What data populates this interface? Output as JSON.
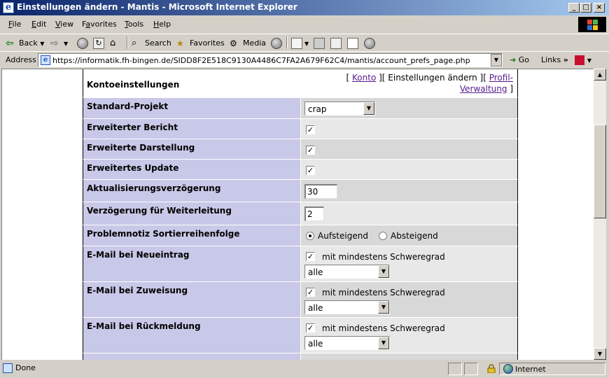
{
  "window": {
    "title": "Einstellungen ändern - Mantis - Microsoft Internet Explorer"
  },
  "menu": [
    {
      "label": "File",
      "key": "F",
      "rest": "ile"
    },
    {
      "label": "Edit",
      "key": "E",
      "rest": "dit"
    },
    {
      "label": "View",
      "key": "V",
      "rest": "iew"
    },
    {
      "label": "Favorites",
      "key": "a",
      "pre": "F",
      "rest": "vorites"
    },
    {
      "label": "Tools",
      "key": "T",
      "rest": "ools"
    },
    {
      "label": "Help",
      "key": "H",
      "rest": "elp"
    }
  ],
  "toolbar": {
    "back": "Back",
    "search": "Search",
    "favorites": "Favorites",
    "media": "Media"
  },
  "address": {
    "label": "Address",
    "url": "https://informatik.fh-bingen.de/SIDD8F2E518C9130A4486C7FA2A679F62C4/mantis/account_prefs_page.php",
    "go": "Go",
    "links": "Links"
  },
  "prefs": {
    "title": "Kontoeinstellungen",
    "link_konto": "Konto",
    "current": " ][ Einstellungen ändern ][ ",
    "link_profil_a": "Profil-",
    "link_profil_b": "Verwaltung",
    "bracket_open": "[ ",
    "bracket_close": " ]",
    "rows": [
      {
        "label": "Standard-Projekt",
        "value": "crap"
      },
      {
        "label": "Erweiterter Bericht",
        "checked": true
      },
      {
        "label": "Erweiterte Darstellung",
        "checked": true
      },
      {
        "label": "Erweitertes Update",
        "checked": true
      },
      {
        "label": "Aktualisierungsverzögerung",
        "value": "30"
      },
      {
        "label": "Verzögerung für Weiterleitung",
        "value": "2"
      },
      {
        "label": "Problemnotiz Sortierreihenfolge",
        "option_a": "Aufsteigend",
        "option_b": "Absteigend",
        "selected": "Aufsteigend"
      },
      {
        "label": "E-Mail bei Neueintrag",
        "check_label": "mit mindestens Schweregrad",
        "severity": "alle"
      },
      {
        "label": "E-Mail bei Zuweisung",
        "check_label": "mit mindestens Schweregrad",
        "severity": "alle"
      },
      {
        "label": "E-Mail bei Rückmeldung",
        "check_label": "mit mindestens Schweregrad",
        "severity": "alle"
      }
    ]
  },
  "status": {
    "text": "Done",
    "zone": "Internet"
  },
  "colors": {
    "label_bg": "#c8c8e8",
    "row_dark": "#d8d8d8",
    "row_light": "#e8e8e8",
    "link": "#551a8b"
  }
}
